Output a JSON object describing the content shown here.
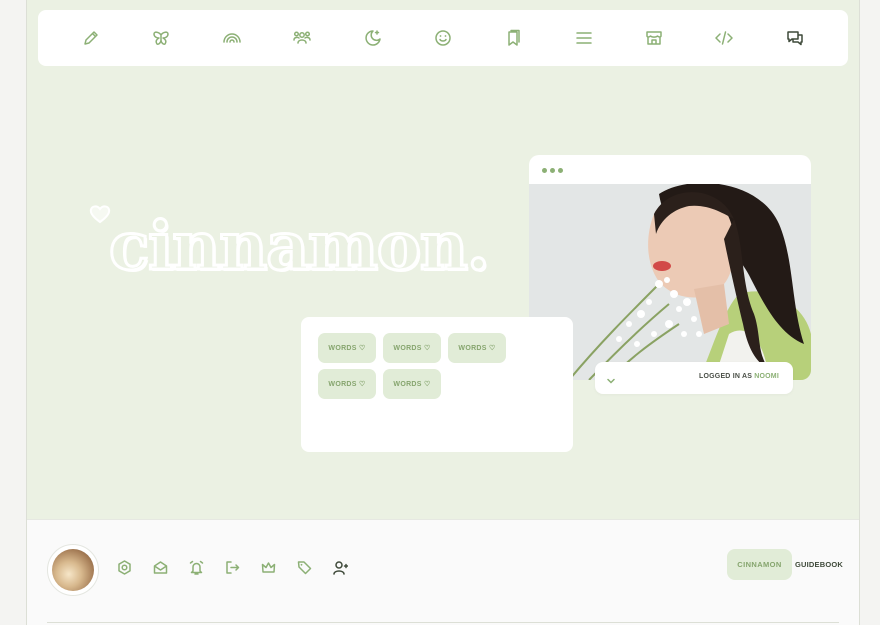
{
  "nav": {
    "icons": [
      "pencil-icon",
      "butterfly-icon",
      "rainbow-icon",
      "group-icon",
      "moon-stars-icon",
      "smiley-icon",
      "bookmarks-icon",
      "menu-icon",
      "store-icon",
      "code-icon",
      "chat-icon"
    ]
  },
  "hero": {
    "title": "cinnamon."
  },
  "profile": {
    "logged_prefix": "LOGGED IN AS ",
    "username": "NOOMI"
  },
  "words": {
    "chips": [
      "WORDS ♡",
      "WORDS ♡",
      "WORDS ♡",
      "WORDS ♡",
      "WORDS ♡"
    ]
  },
  "footer": {
    "icons": [
      "settings-hex-icon",
      "mail-icon",
      "alarm-icon",
      "logout-icon",
      "crown-icon",
      "tag-icon",
      "add-user-icon"
    ],
    "primary_button": "CINNAMON",
    "secondary_button": "GUIDEBOOK"
  },
  "colors": {
    "accent": "#8cb075",
    "background": "#ebf1e3",
    "chip": "#e1ecd7"
  }
}
